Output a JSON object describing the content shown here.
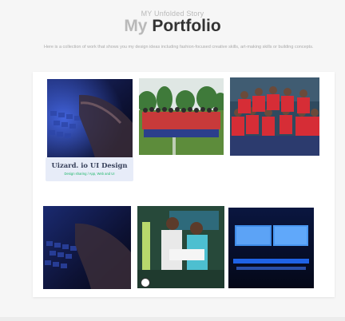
{
  "header": {
    "eyebrow": "MY Unfolded Story",
    "title_my": "My",
    "title_main": "Portfolio",
    "description": "Here is a collection of work that shows you my design ideas including fashion-focused creative skills, art-making skills or building concepts."
  },
  "gallery": {
    "featured_caption": {
      "title": "Uizard. io UI Design",
      "subtitle": "Design sharing / App, Web and UI"
    }
  },
  "colors": {
    "background": "#f6f6f6",
    "card": "#ffffff",
    "caption_bg": "#e7ecf8",
    "caption_title": "#37405a",
    "caption_sub": "#1fb86b"
  }
}
